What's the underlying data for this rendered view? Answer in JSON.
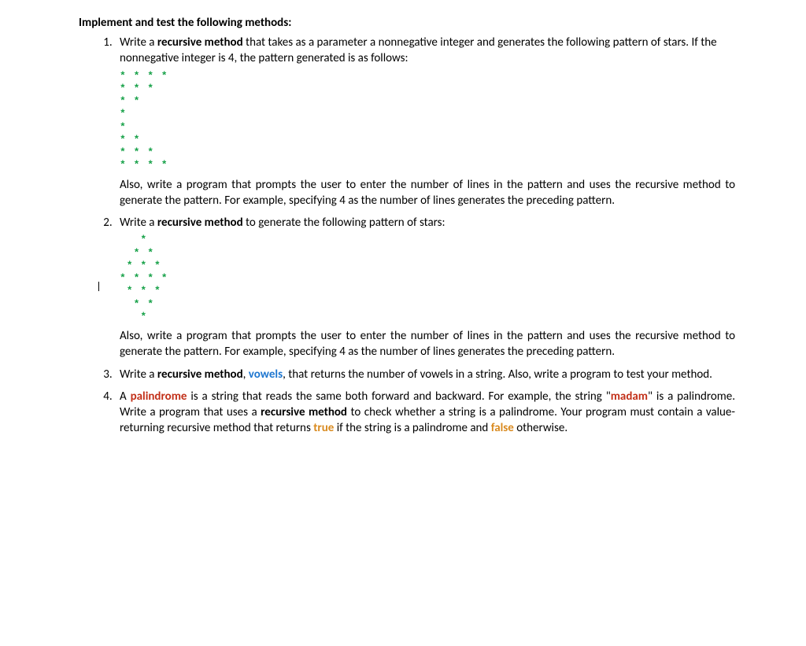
{
  "heading": "Implement and test the following methods:",
  "items": [
    {
      "intro_pre": "Write a ",
      "intro_bold": "recursive method",
      "intro_post": " that takes as a parameter a nonnegative integer and generates the following pattern of stars. If the nonnegative integer is 4, the pattern generated is as follows:",
      "stars": "* * * *\n* * *\n* *\n*\n*\n* *\n* * *\n* * * *",
      "also": "Also, write a program that prompts the user to enter the number of lines in the pattern and uses the recursive method to generate the pattern. For example, specifying 4 as the number of lines generates the preceding pattern."
    },
    {
      "intro_pre": "Write a ",
      "intro_bold": "recursive method",
      "intro_post": " to generate the following pattern of stars:",
      "stars": "   *\n  * *\n * * *\n* * * *\n * * *\n  * *\n   *",
      "also": "Also, write a program that prompts the user to enter the number of lines in the pattern and uses the recursive method to generate the pattern. For example, specifying 4 as the number of lines generates the preceding pattern."
    },
    {
      "intro_pre": "Write a ",
      "intro_bold": "recursive method",
      "intro_mid": ", ",
      "intro_blue": "vowels",
      "intro_post": ", that returns the number of vowels in a string. Also, write a program to test your method."
    },
    {
      "p_pre": "A ",
      "p_red1": "palindrome",
      "p_mid1": " is a string that reads the same both forward and backward. For example, the string \"",
      "p_red2": "madam",
      "p_mid2": "\" is a palindrome. Write a program that uses a ",
      "p_bold": "recursive method",
      "p_mid3": " to check whether a string is a palindrome. Your program must contain a value-returning recursive method that returns ",
      "p_true": "true",
      "p_mid4": " if the string is a palindrome and ",
      "p_false": "false",
      "p_end": " otherwise."
    }
  ]
}
